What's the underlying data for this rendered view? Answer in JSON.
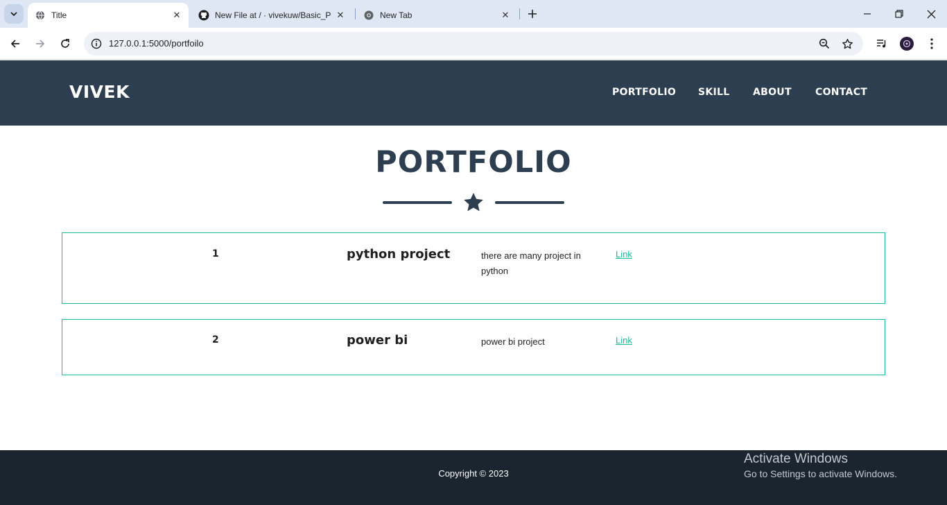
{
  "browser": {
    "tabs": [
      {
        "title": "Title",
        "icon": "globe-icon",
        "active": true
      },
      {
        "title": "New File at / · vivekuw/Basic_Po",
        "icon": "github-icon",
        "active": false
      },
      {
        "title": "New Tab",
        "icon": "chrome-icon",
        "active": false
      }
    ],
    "url": "127.0.0.1:5000/portfoilo"
  },
  "site": {
    "brand": "VIVEK",
    "nav": [
      "PORTFOLIO",
      "SKILL",
      "ABOUT",
      "CONTACT"
    ],
    "heading": "PORTFOLIO",
    "projects": [
      {
        "number": "1",
        "title": "python project",
        "description": "there are many project in python",
        "link": "Link"
      },
      {
        "number": "2",
        "title": "power bi",
        "description": "power bi project",
        "link": "Link"
      }
    ],
    "footer": "Copyright © 2023"
  },
  "overlay": {
    "activate_title": "Activate Windows",
    "activate_subtitle": "Go to Settings to activate Windows."
  },
  "colors": {
    "header": "#2c3e50",
    "footer": "#1a252f",
    "accent": "#18bc9c"
  }
}
